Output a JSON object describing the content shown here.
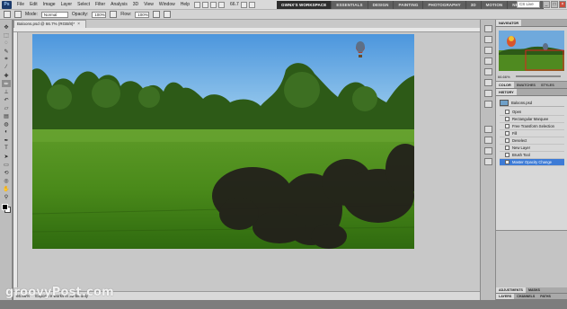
{
  "app": {
    "logo": "Ps"
  },
  "menu": [
    "File",
    "Edit",
    "Image",
    "Layer",
    "Select",
    "Filter",
    "Analysis",
    "3D",
    "View",
    "Window",
    "Help"
  ],
  "toolbar_zoom": "66.7",
  "workspaces": [
    "GWNX'S WORKSPACE",
    "ESSENTIALS",
    "DESIGN",
    "PAINTING",
    "PHOTOGRAPHY",
    "3D",
    "MOTION",
    "NEW IN CS 5"
  ],
  "search": {
    "placeholder": "CS Live"
  },
  "options": {
    "mode_label": "Mode:",
    "mode_value": "Normal",
    "opacity_label": "Opacity:",
    "opacity_value": "100%",
    "flow_label": "Flow:",
    "flow_value": "100%"
  },
  "document": {
    "tab_title": "Baloons.psd @ 66.7% (RGB/8)*",
    "zoom_status": "66.66%",
    "status_text": "Exposure works in 32-bit only"
  },
  "panels": {
    "navigator_tabs": [
      "NAVIGATOR"
    ],
    "navigator_zoom": "66.66%",
    "color_tabs": [
      "COLOR",
      "SWATCHES",
      "STYLES"
    ],
    "history_tabs": [
      "HISTORY"
    ],
    "history_snapshot": "Baloons.psd",
    "history_items": [
      "Open",
      "Rectangular Marquee",
      "Free Transform Selection",
      "Fill",
      "Deselect",
      "New Layer",
      "Brush Tool",
      "Master Opacity Change"
    ],
    "history_selected_index": 7,
    "adjustment_tabs": [
      "ADJUSTMENTS",
      "MASKS"
    ],
    "layer_tabs": [
      "LAYERS",
      "CHANNELS",
      "PATHS"
    ]
  },
  "watermark": "groovyPost.com",
  "colors": {
    "sky": "#78b6e6",
    "grass": "#4e8a1e",
    "paint": "#221f1b",
    "selection": "#3d7bd6"
  }
}
